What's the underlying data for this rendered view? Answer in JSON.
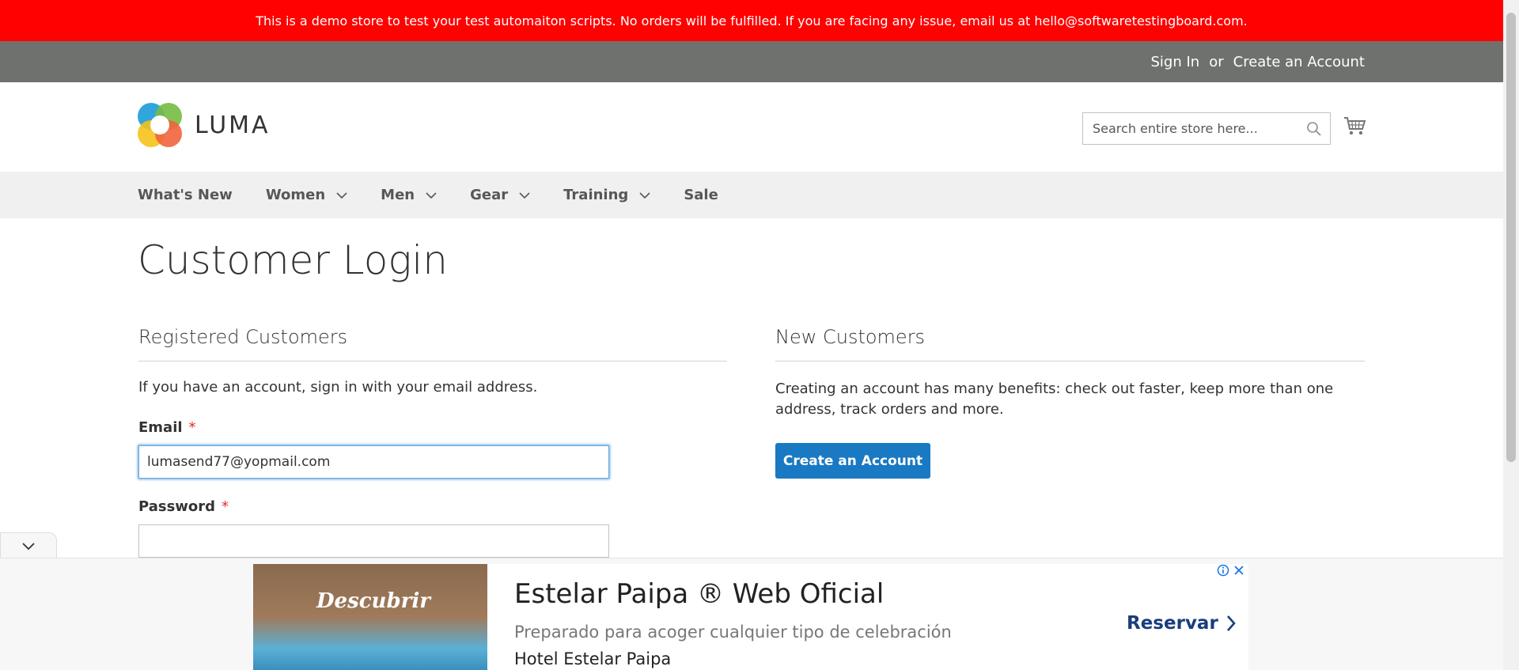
{
  "notice": {
    "text": "This is a demo store to test your test automaiton scripts. No orders will be fulfilled. If you are facing any issue, email us at hello@softwaretestingboard.com."
  },
  "header": {
    "sign_in": "Sign In",
    "or": "or",
    "create_account": "Create an Account",
    "logo_text": "LUMA",
    "search_placeholder": "Search entire store here..."
  },
  "nav": {
    "items": [
      {
        "label": "What's New",
        "has_dropdown": false
      },
      {
        "label": "Women",
        "has_dropdown": true
      },
      {
        "label": "Men",
        "has_dropdown": true
      },
      {
        "label": "Gear",
        "has_dropdown": true
      },
      {
        "label": "Training",
        "has_dropdown": true
      },
      {
        "label": "Sale",
        "has_dropdown": false
      }
    ]
  },
  "page": {
    "title": "Customer Login"
  },
  "registered": {
    "title": "Registered Customers",
    "intro": "If you have an account, sign in with your email address.",
    "email_label": "Email",
    "email_value": "lumasend77@yopmail.com",
    "password_label": "Password",
    "password_value": "",
    "required_marker": "*"
  },
  "new_customers": {
    "title": "New Customers",
    "description": "Creating an account has many benefits: check out faster, keep more than one address, track orders and more.",
    "button_label": "Create an Account"
  },
  "ad": {
    "headline": "Estelar Paipa ® Web Oficial",
    "description": "Preparado para acoger cualquier tipo de celebración",
    "brand": "Hotel Estelar Paipa",
    "cta": "Reservar",
    "image_text": "Descubrir"
  },
  "colors": {
    "notice_bg": "#ff0101",
    "header_bg": "#6e716e",
    "nav_bg": "#f0f0f0",
    "primary_button": "#1979c3",
    "required": "#e02b27"
  }
}
